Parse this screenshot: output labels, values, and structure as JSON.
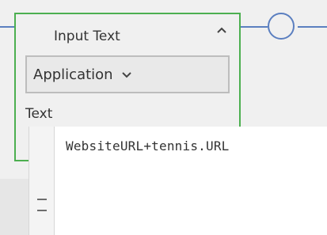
{
  "activity": {
    "title": "Input Text",
    "collapse_icon": "chevron-up-icon",
    "application_dropdown_label": "Application",
    "dropdown_icon": "chevron-down-icon",
    "text_label": "Text"
  },
  "editor": {
    "value": "WebsiteURL+tennis.URL",
    "gutter_icon": "drag-handle-icon"
  },
  "colors": {
    "activity_border": "#4caf50",
    "connector": "#5b7fc0",
    "background": "#f0f0f0",
    "editor_background": "#ffffff"
  }
}
